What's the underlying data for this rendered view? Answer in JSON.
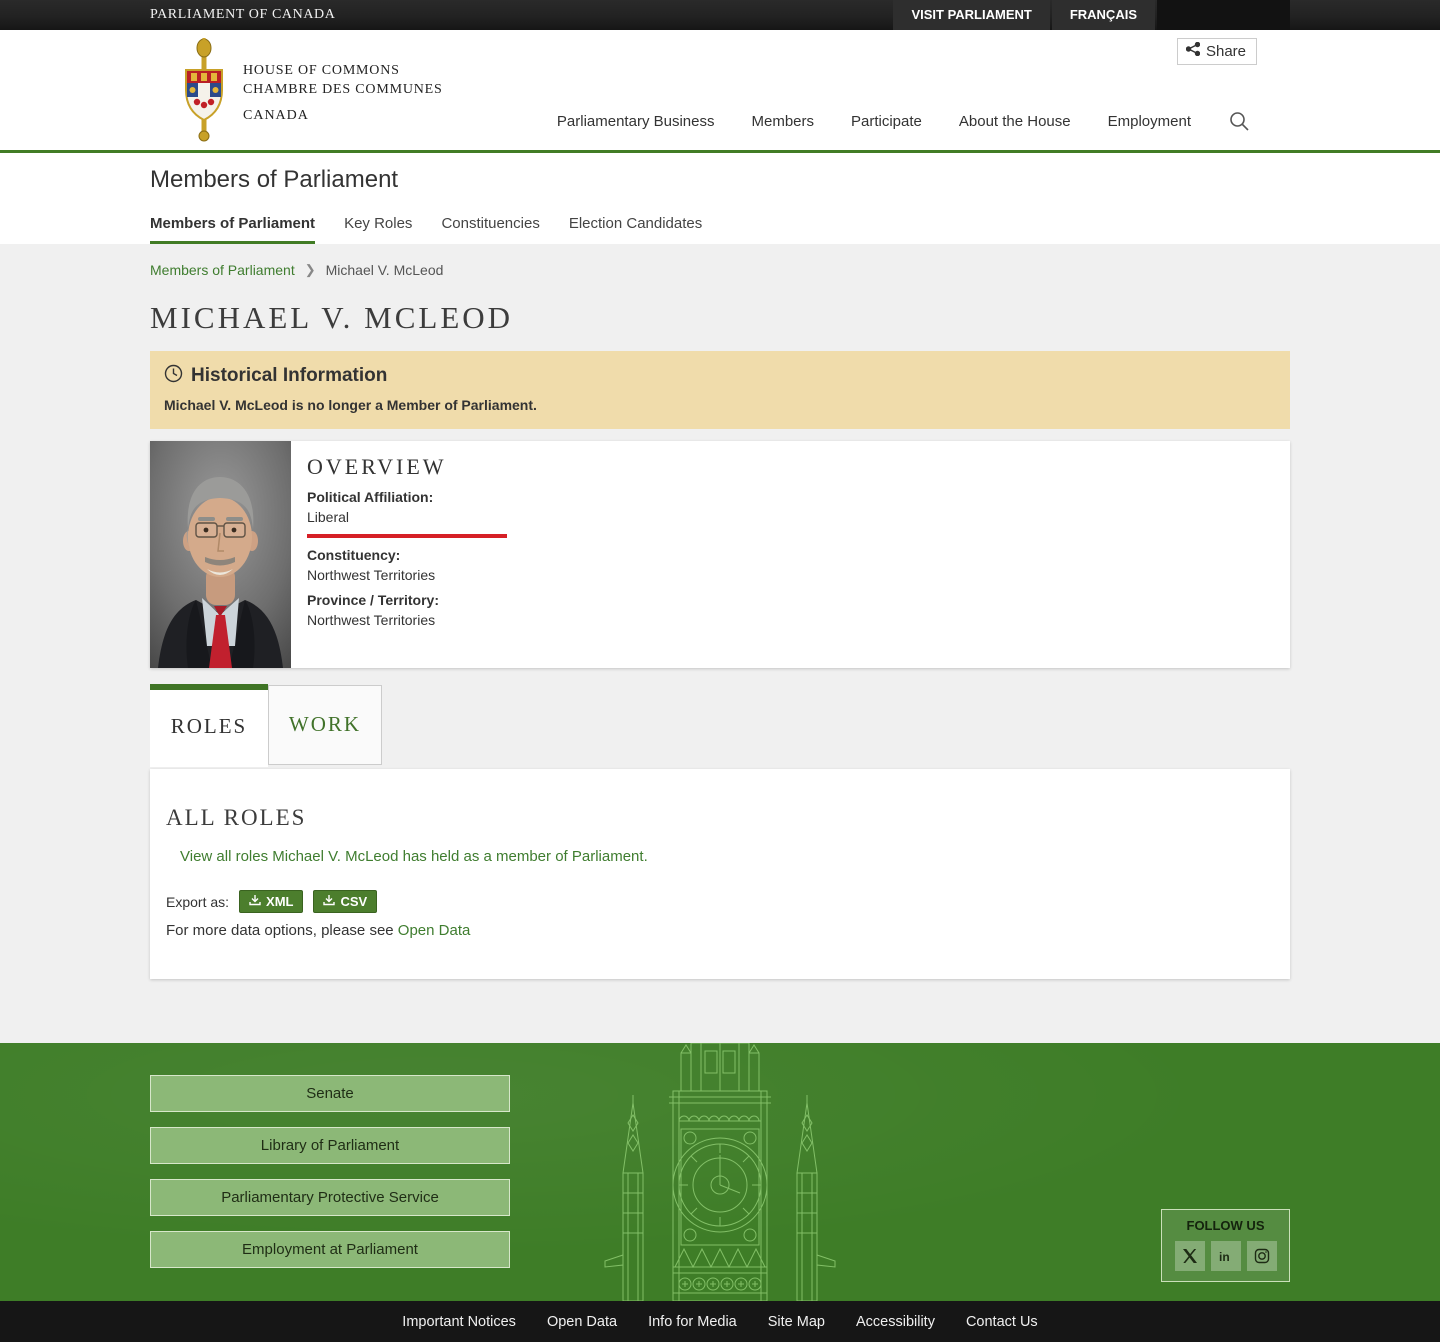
{
  "colors": {
    "accent_green": "#3f7425",
    "link_green": "#3f7d2f",
    "button_light_green": "#8cb877",
    "footer_green": "#3e7d27",
    "liberal_red": "#d61f26",
    "notice_bg": "#f0dcab"
  },
  "top_bar": {
    "brand": "PARLIAMENT OF CANADA",
    "links": [
      "VISIT PARLIAMENT",
      "FRANÇAIS"
    ]
  },
  "header": {
    "logo": {
      "line1": "HOUSE OF COMMONS",
      "line2": "CHAMBRE DES COMMUNES",
      "line3": "CANADA"
    },
    "share_label": "Share",
    "nav": [
      "Parliamentary Business",
      "Members",
      "Participate",
      "About the House",
      "Employment"
    ]
  },
  "section": {
    "title": "Members of Parliament",
    "tabs": [
      "Members of Parliament",
      "Key Roles",
      "Constituencies",
      "Election Candidates"
    ]
  },
  "breadcrumb": {
    "parent": "Members of Parliament",
    "current": "Michael V. McLeod"
  },
  "member": {
    "name": "MICHAEL V. MCLEOD",
    "notice": {
      "title": "Historical Information",
      "message": "Michael V. McLeod is no longer a Member of Parliament."
    },
    "overview": {
      "heading": "OVERVIEW",
      "political_affiliation_label": "Political Affiliation:",
      "political_affiliation": "Liberal",
      "constituency_label": "Constituency:",
      "constituency": "Northwest Territories",
      "province_label": "Province / Territory:",
      "province": "Northwest Territories"
    }
  },
  "content_tabs": [
    "ROLES",
    "WORK"
  ],
  "roles_panel": {
    "heading": "ALL ROLES",
    "view_all_link": "View all roles Michael V. McLeod has held as a member of Parliament.",
    "export_label": "Export as:",
    "export_buttons": [
      "XML",
      "CSV"
    ],
    "more_text": "For more data options, please see ",
    "more_link": "Open Data"
  },
  "footer": {
    "buttons": [
      "Senate",
      "Library of Parliament",
      "Parliamentary Protective Service",
      "Employment at Parliament"
    ],
    "follow_label": "FOLLOW US",
    "links": [
      "Important Notices",
      "Open Data",
      "Info for Media",
      "Site Map",
      "Accessibility",
      "Contact Us"
    ]
  }
}
